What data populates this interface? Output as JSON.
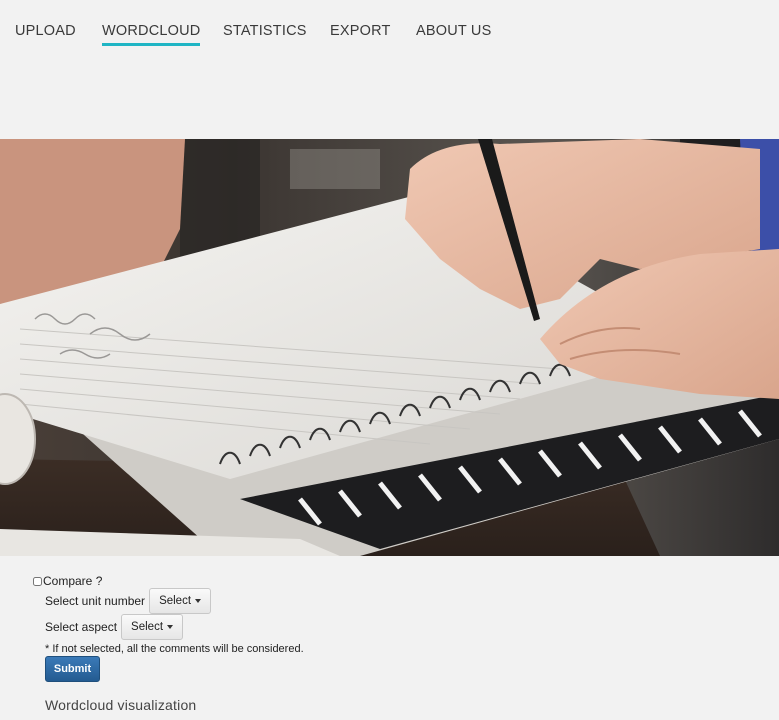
{
  "nav": {
    "items": [
      {
        "label": "UPLOAD",
        "active": false
      },
      {
        "label": "WORDCLOUD",
        "active": true
      },
      {
        "label": "STATISTICS",
        "active": false
      },
      {
        "label": "EXPORT",
        "active": false
      },
      {
        "label": "ABOUT US",
        "active": false
      }
    ],
    "accent_color": "#1fb5c4"
  },
  "hero": {
    "image": "photo-notebook-hand-writing"
  },
  "form": {
    "compare_label": "Compare ?",
    "compare_checked": false,
    "unit_label": "Select unit number",
    "unit_select": "Select",
    "aspect_label": "Select aspect",
    "aspect_select": "Select",
    "note": "* If not selected, all the comments will be considered.",
    "submit_label": "Submit"
  },
  "section": {
    "title": "Wordcloud visualization"
  }
}
